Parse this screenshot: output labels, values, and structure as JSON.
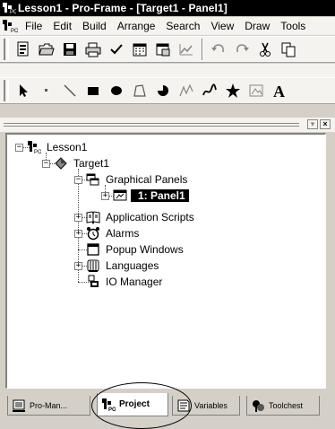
{
  "window": {
    "title": "Lesson1 - Pro-Frame - [Target1 - Panel1]",
    "app_icon": "proframe-logo-icon"
  },
  "menu": {
    "items": [
      "File",
      "Edit",
      "Build",
      "Arrange",
      "Search",
      "View",
      "Draw",
      "Tools"
    ]
  },
  "toolbar1": {
    "buttons": [
      "new",
      "open",
      "save",
      "print",
      "check",
      "calendar",
      "panel",
      "graph",
      "undo",
      "redo",
      "cut",
      "copy"
    ]
  },
  "toolbar2": {
    "buttons": [
      "select-arrow",
      "point",
      "line",
      "rectangle",
      "ellipse",
      "polygon",
      "pie",
      "polyline",
      "freehand",
      "star",
      "bitmap",
      "text"
    ],
    "text_tool_glyph": "A"
  },
  "tree": {
    "root": "Lesson1",
    "target": "Target1",
    "graphical_panels": "Graphical Panels",
    "panel1": "1: Panel1",
    "application_scripts": "Application Scripts",
    "alarms": "Alarms",
    "popup_windows": "Popup Windows",
    "languages": "Languages",
    "io_manager": "IO Manager"
  },
  "tabs": {
    "pro_manager": "Pro-Man...",
    "project": "Project",
    "variables": "Variables",
    "toolchest": "Toolchest",
    "active": "Project"
  }
}
